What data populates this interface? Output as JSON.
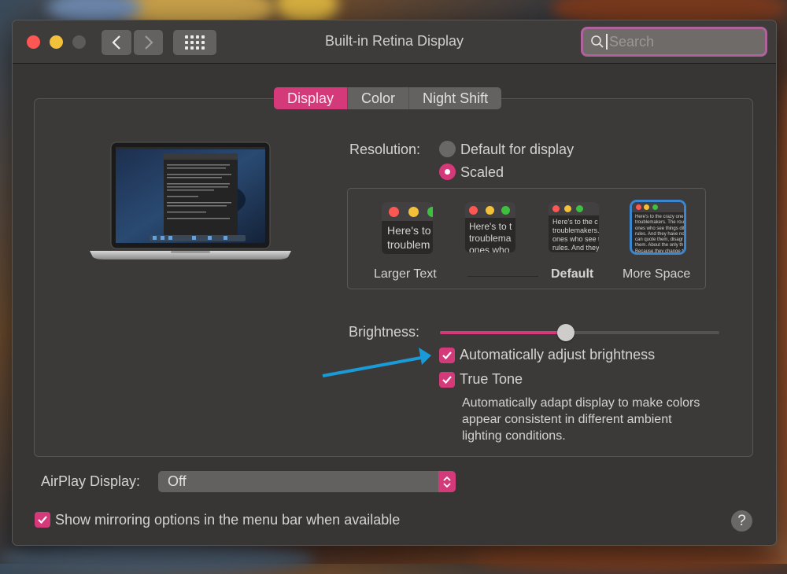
{
  "window": {
    "title": "Built-in Retina Display",
    "search_placeholder": "Search",
    "search_value": ""
  },
  "tabs": [
    {
      "label": "Display",
      "active": true
    },
    {
      "label": "Color",
      "active": false
    },
    {
      "label": "Night Shift",
      "active": false
    }
  ],
  "resolution": {
    "label": "Resolution:",
    "options": [
      {
        "label": "Default for display",
        "selected": false
      },
      {
        "label": "Scaled",
        "selected": true
      }
    ],
    "scaled_options": [
      {
        "label": "Larger Text",
        "preview": "Here's to\ntroublem",
        "selected": false
      },
      {
        "label": "",
        "preview": "Here's to t\ntroublema\nones who",
        "selected": false
      },
      {
        "label": "Default",
        "preview": "Here's to the c\ntroublemakers.\nones who see t\nrules. And they",
        "selected": false
      },
      {
        "label": "More Space",
        "preview": "Here's to the crazy one\ntroublemakers. The rou\nones who see things dif\nrules. And they have no\ncan quote them, disagr\nthem. About the only th\nBecause they change t",
        "selected": true
      }
    ]
  },
  "brightness": {
    "label": "Brightness:",
    "value_percent": 45
  },
  "checkboxes": {
    "auto_brightness": {
      "label": "Automatically adjust brightness",
      "checked": true
    },
    "true_tone": {
      "label": "True Tone",
      "checked": true
    },
    "true_tone_description": "Automatically adapt display to make colors appear consistent in different ambient lighting conditions.",
    "show_mirroring": {
      "label": "Show mirroring options in the menu bar when available",
      "checked": true
    }
  },
  "airplay": {
    "label": "AirPlay Display:",
    "value": "Off"
  },
  "help_label": "?",
  "colors": {
    "accent": "#d43a7a",
    "annotation_arrow": "#1a9ad6",
    "selection_outline": "#3b86d1"
  }
}
